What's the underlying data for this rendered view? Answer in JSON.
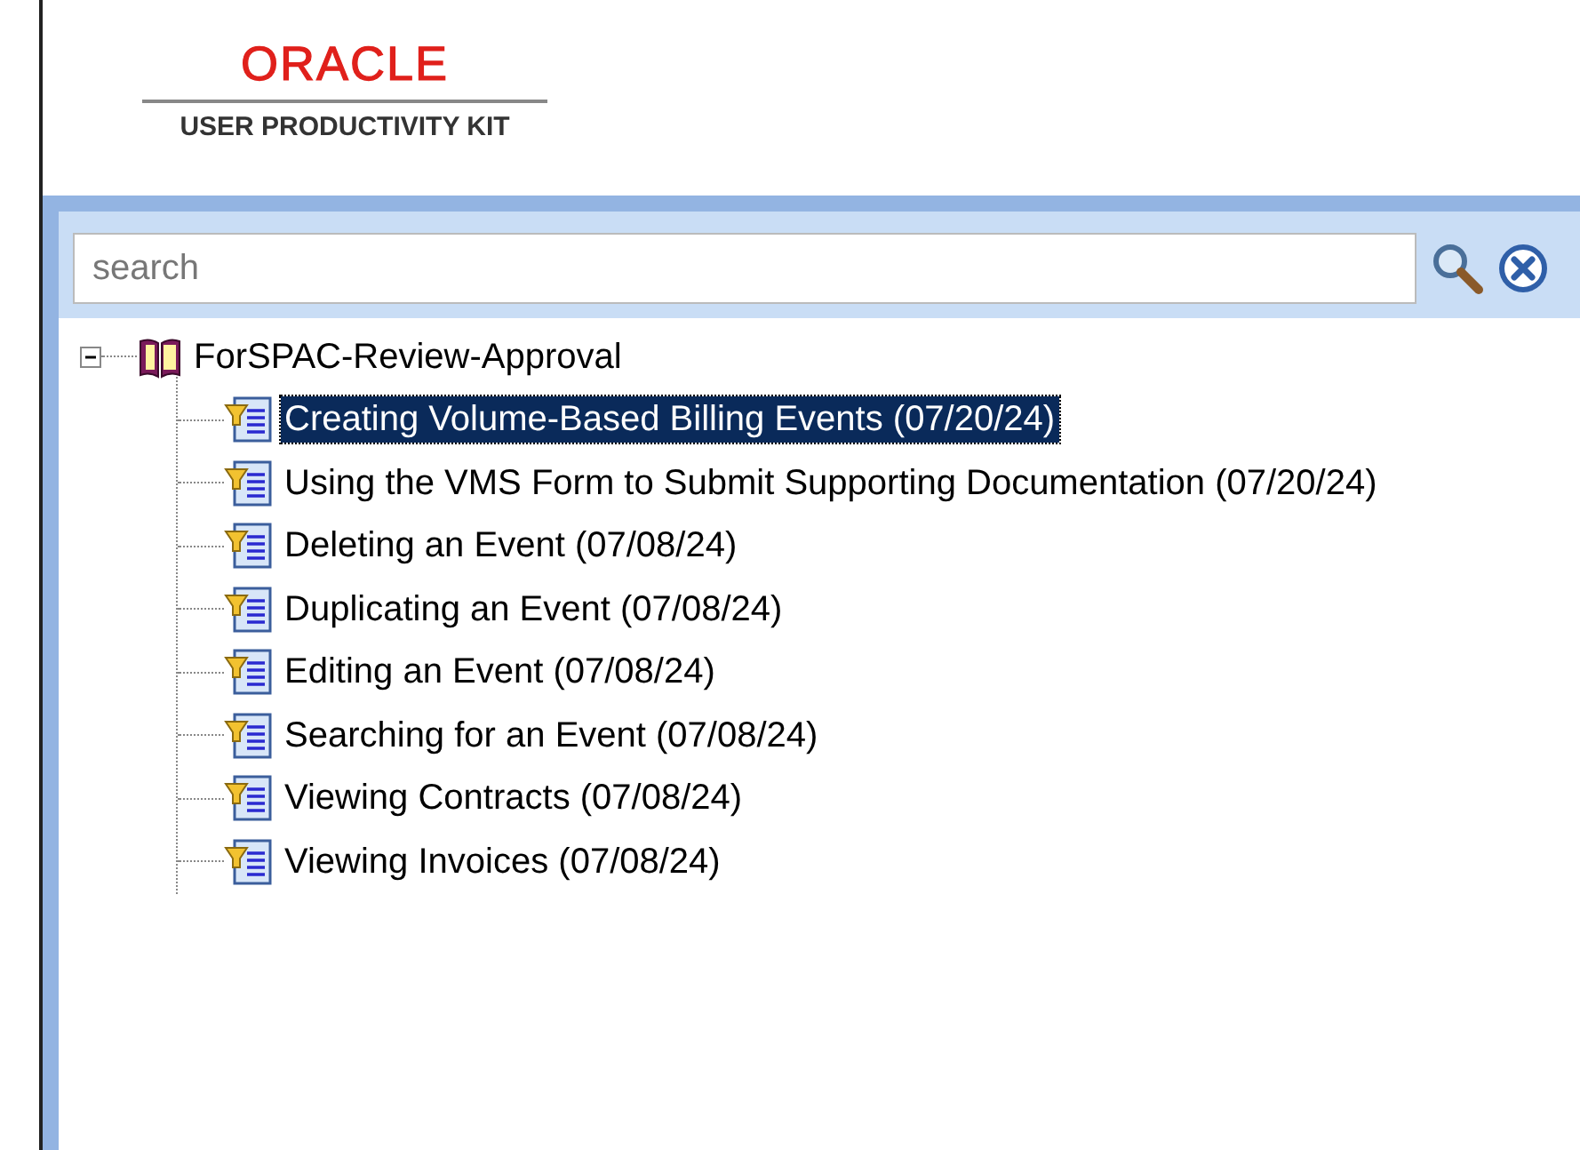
{
  "logo": {
    "brand": "ORACLE",
    "product": "USER PRODUCTIVITY KIT"
  },
  "search": {
    "placeholder": "search"
  },
  "tree": [
    {
      "label": "ForSPAC-Review-Approval",
      "kind": "book",
      "expanded": true,
      "selected": false,
      "children": [
        {
          "label": "Creating Volume-Based Billing Events (07/20/24)",
          "kind": "topic",
          "selected": true
        },
        {
          "label": "Using the VMS Form to Submit Supporting Documentation (07/20/24)",
          "kind": "topic",
          "selected": false
        },
        {
          "label": "Deleting an Event (07/08/24)",
          "kind": "topic",
          "selected": false
        },
        {
          "label": "Duplicating an Event (07/08/24)",
          "kind": "topic",
          "selected": false
        },
        {
          "label": "Editing an Event (07/08/24)",
          "kind": "topic",
          "selected": false
        },
        {
          "label": "Searching for an Event (07/08/24)",
          "kind": "topic",
          "selected": false
        },
        {
          "label": "Viewing Contracts (07/08/24)",
          "kind": "topic",
          "selected": false
        },
        {
          "label": "Viewing Invoices (07/08/24)",
          "kind": "topic",
          "selected": false
        }
      ]
    }
  ]
}
